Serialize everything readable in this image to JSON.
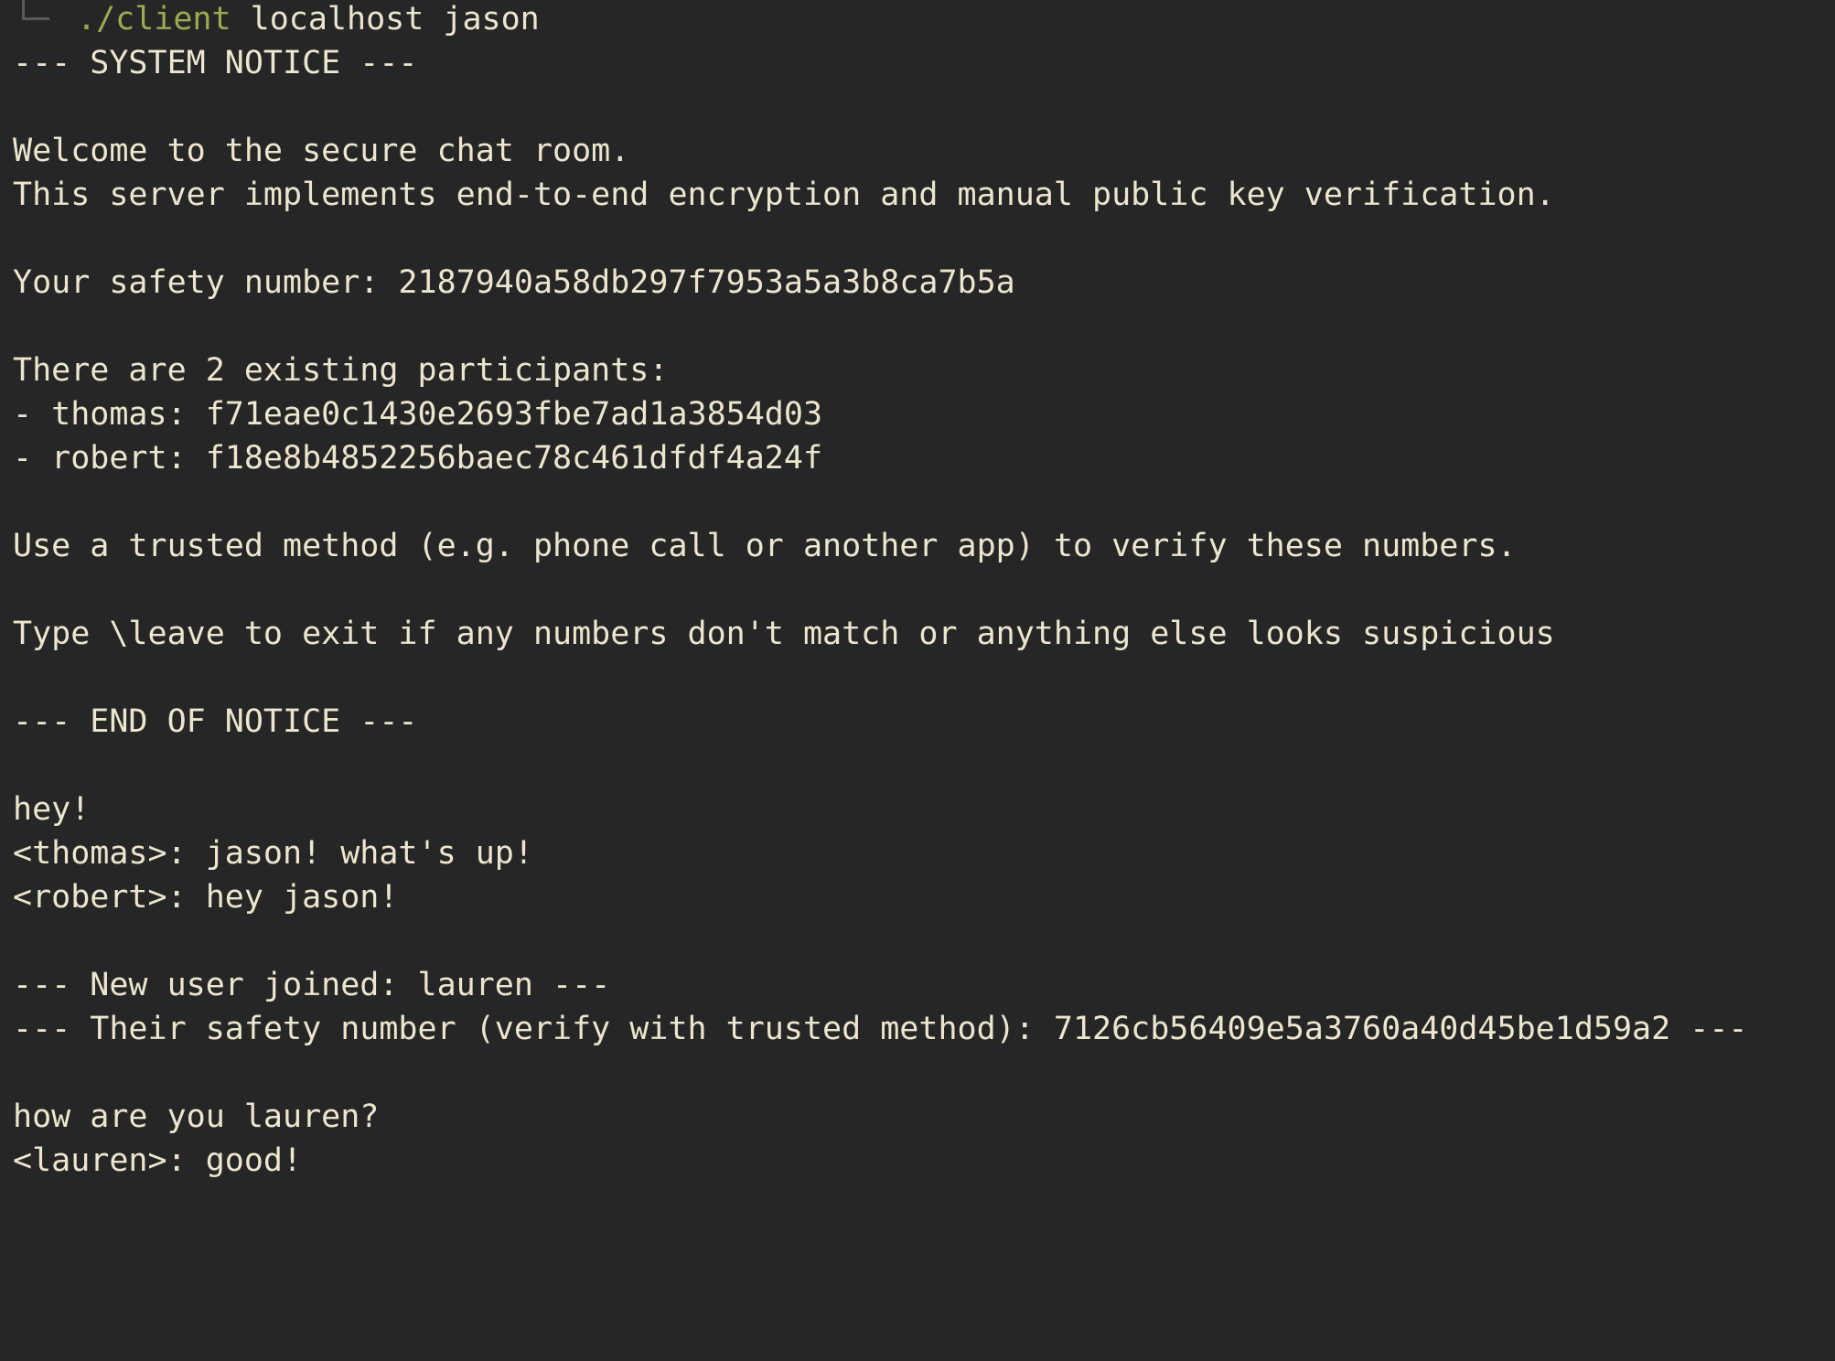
{
  "terminal": {
    "command": {
      "path": "./client",
      "args": " localhost jason"
    },
    "lines": [
      "--- SYSTEM NOTICE ---",
      "Welcome to the secure chat room.",
      "This server implements end-to-end encryption and manual public key verification.",
      "Your safety number: 2187940a58db297f7953a5a3b8ca7b5a",
      "There are 2 existing participants:",
      "- thomas: f71eae0c1430e2693fbe7ad1a3854d03",
      "- robert: f18e8b4852256baec78c461dfdf4a24f",
      "Use a trusted method (e.g. phone call or another app) to verify these numbers.",
      "Type \\leave to exit if any numbers don't match or anything else looks suspicious",
      "--- END OF NOTICE ---",
      "hey!",
      "<thomas>: jason! what's up!",
      "<robert>: hey jason!",
      "--- New user joined: lauren ---",
      "--- Their safety number (verify with trusted method): 7126cb56409e5a3760a40d45be1d59a2 ---",
      "how are you lauren?",
      "<lauren>: good!"
    ]
  }
}
